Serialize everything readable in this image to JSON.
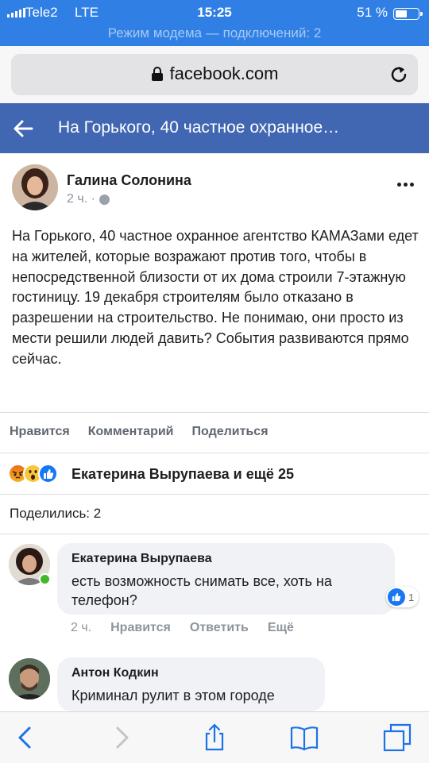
{
  "status_bar": {
    "carrier": "Tele2",
    "network": "LTE",
    "time": "15:25",
    "battery_percent": "51 %",
    "battery_level": 0.51,
    "hotspot_text": "Режим модема — подключений: 2"
  },
  "browser": {
    "url": "facebook.com",
    "icons": [
      "lock-icon",
      "reload-icon",
      "back-icon",
      "forward-icon",
      "share-icon",
      "bookmarks-icon",
      "tabs-icon"
    ]
  },
  "header": {
    "title": "На Горького, 40 частное охранное…",
    "back_icon": "back-arrow-icon",
    "bg_color": "#4267b2"
  },
  "post": {
    "author": "Галина Солонина",
    "time": "2 ч. ·",
    "text": "На Горького, 40 частное охранное агентство КАМАЗами едет на жителей, которые возражают против того, чтобы в непосредственной близости от их дома строили 7-этажную гостиницу. 19 декабря строителям было отказано в разрешении на строительство. Не понимаю, они просто из мести решили людей давить? События развиваются прямо сейчас.",
    "actions": {
      "like": "Нравится",
      "comment": "Комментарий",
      "share": "Поделиться"
    },
    "reactions_text": "Екатерина Вырупаева и ещё 25",
    "reaction_icons": [
      "angry-icon",
      "wow-icon",
      "like-icon"
    ],
    "shares_text": "Поделились: 2"
  },
  "comments": [
    {
      "author": "Екатерина Вырупаева",
      "text": "есть возможность снимать все, хоть на телефон?",
      "like_count": "1",
      "time": "2 ч.",
      "like": "Нравится",
      "reply": "Ответить",
      "more": "Ещё"
    },
    {
      "author": "Антон Кодкин",
      "text": "Криминал рулит в этом городе"
    }
  ]
}
